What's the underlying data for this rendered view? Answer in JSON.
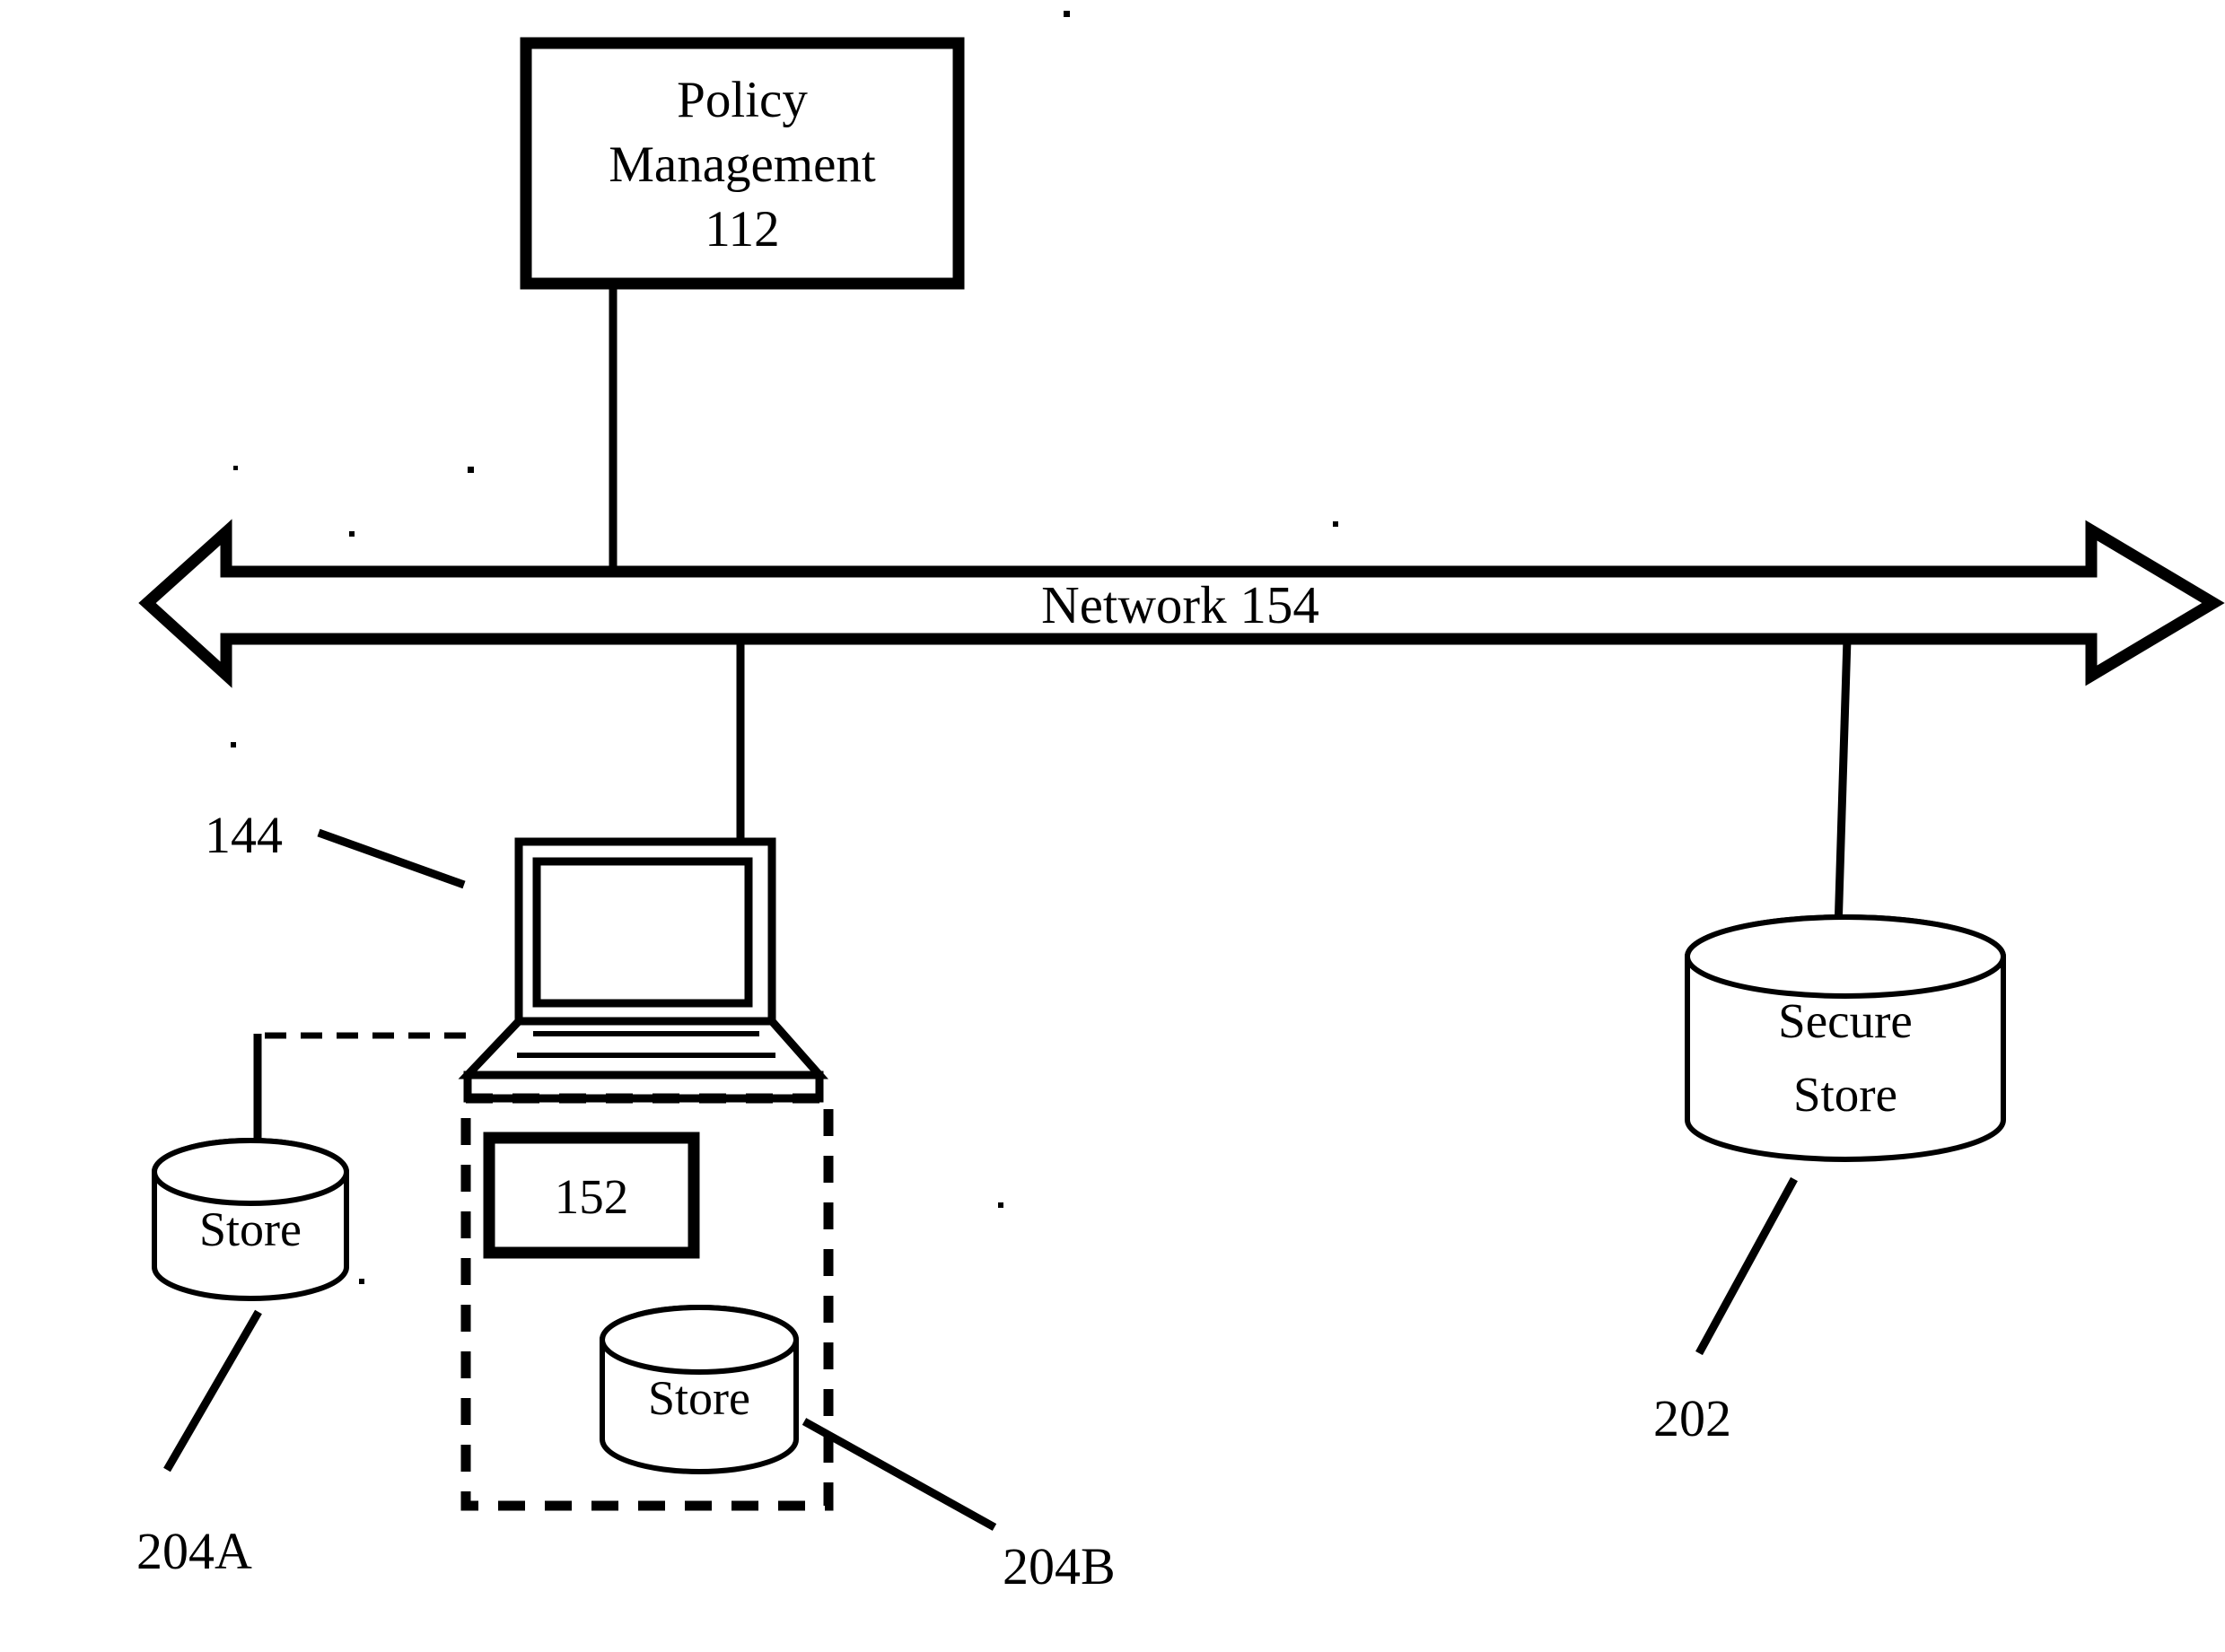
{
  "figure": {
    "title": "Network policy management block diagram",
    "background_color": "#ffffff",
    "line_color": "#000000"
  },
  "nodes": {
    "policy_management": {
      "label_line1": "Policy",
      "label_line2": "Management",
      "label_line3": "112",
      "reference_numeral": "112",
      "shape": "rectangle"
    },
    "network": {
      "label": "Network 154",
      "reference_numeral": "154",
      "shape": "double-headed-arrow-bus"
    },
    "laptop": {
      "reference_numeral": "144",
      "shape": "laptop-computer"
    },
    "client_module": {
      "label": "152",
      "reference_numeral": "152",
      "shape": "rectangle"
    },
    "store_external": {
      "label": "Store",
      "reference_numeral": "204A",
      "shape": "cylinder"
    },
    "store_internal": {
      "label": "Store",
      "reference_numeral": "204B",
      "shape": "cylinder"
    },
    "secure_store": {
      "label_line1": "Secure",
      "label_line2": "Store",
      "reference_numeral": "202",
      "shape": "cylinder"
    }
  },
  "reference_labels": {
    "laptop_ref": "144",
    "store_external_ref": "204A",
    "store_internal_ref": "204B",
    "secure_store_ref": "202"
  },
  "connections": [
    {
      "from": "policy_management",
      "to": "network",
      "style": "solid"
    },
    {
      "from": "network",
      "to": "laptop",
      "style": "solid"
    },
    {
      "from": "network",
      "to": "secure_store",
      "style": "solid"
    },
    {
      "from": "laptop",
      "to": "store_external",
      "style": "dashed"
    }
  ]
}
